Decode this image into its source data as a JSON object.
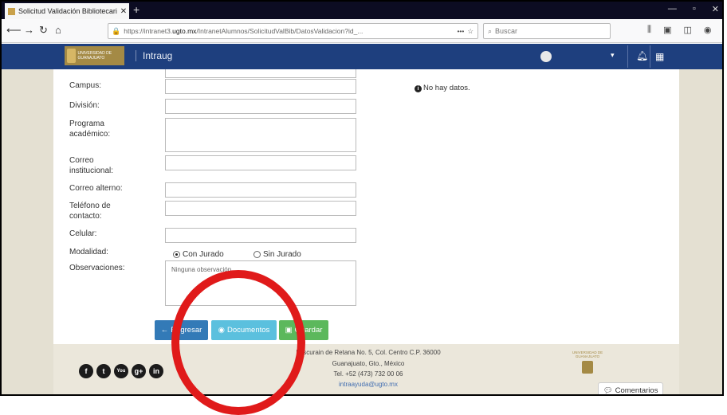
{
  "browser": {
    "tab_title": "Solicitud Validación Bibliotecari",
    "tab_close": "✕",
    "new_tab": "+",
    "window_controls": [
      "—",
      "▫",
      "✕"
    ],
    "nav": {
      "back": "⟵",
      "forward": "→",
      "reload": "↻",
      "home": "⌂"
    },
    "url_prefix": "https://intranet3.",
    "url_domain": "ugto.mx",
    "url_path": "/IntranetAlumnos/SolicitudValBib/DatosValidacion?id_...",
    "url_more": "•••",
    "search_placeholder": "Buscar",
    "toolbar_icons": [
      "library-icon",
      "reader-icon",
      "sidebar-icon",
      "account-icon",
      "menu-icon"
    ]
  },
  "header": {
    "logo_text": "UNIVERSIDAD DE GUANAJUATO",
    "site_name": "Intraug",
    "caret": "▾",
    "bell": "🔔",
    "grid": "▦"
  },
  "form": {
    "labels": {
      "campus": "Campus:",
      "division": "División:",
      "programa_1": "Programa",
      "programa_2": "académico:",
      "correo_inst_1": "Correo",
      "correo_inst_2": "institucional:",
      "correo_alterno": "Correo alterno:",
      "telefono_1": "Teléfono de",
      "telefono_2": "contacto:",
      "celular": "Celular:",
      "modalidad": "Modalidad:",
      "observaciones": "Observaciones:"
    },
    "values": {
      "campus": "",
      "division": "",
      "programa": "",
      "correo_institucional": "",
      "correo_alterno": "",
      "telefono": "",
      "celular": ""
    },
    "modalidad_options": [
      {
        "label": "Con Jurado",
        "selected": true
      },
      {
        "label": "Sin Jurado",
        "selected": false
      }
    ],
    "observaciones": "Ninguna observación",
    "no_data": "No hay datos.",
    "buttons": {
      "back": "Regresar",
      "documents": "Documentos",
      "save": "Guardar"
    }
  },
  "footer": {
    "address_1": "Lascurain de Retana No. 5, Col. Centro C.P. 36000",
    "address_2": "Guanajuato, Gto., México",
    "phone": "Tel. +52 (473) 732 00 06",
    "email": "intraayuda@ugto.mx",
    "logo_text": "UNIVERSIDAD DE GUANAJUATO",
    "social": [
      "f",
      "t",
      "You",
      "g+",
      "in"
    ],
    "comentarios": "Comentarios"
  },
  "annotation_color": "#e01a1a"
}
